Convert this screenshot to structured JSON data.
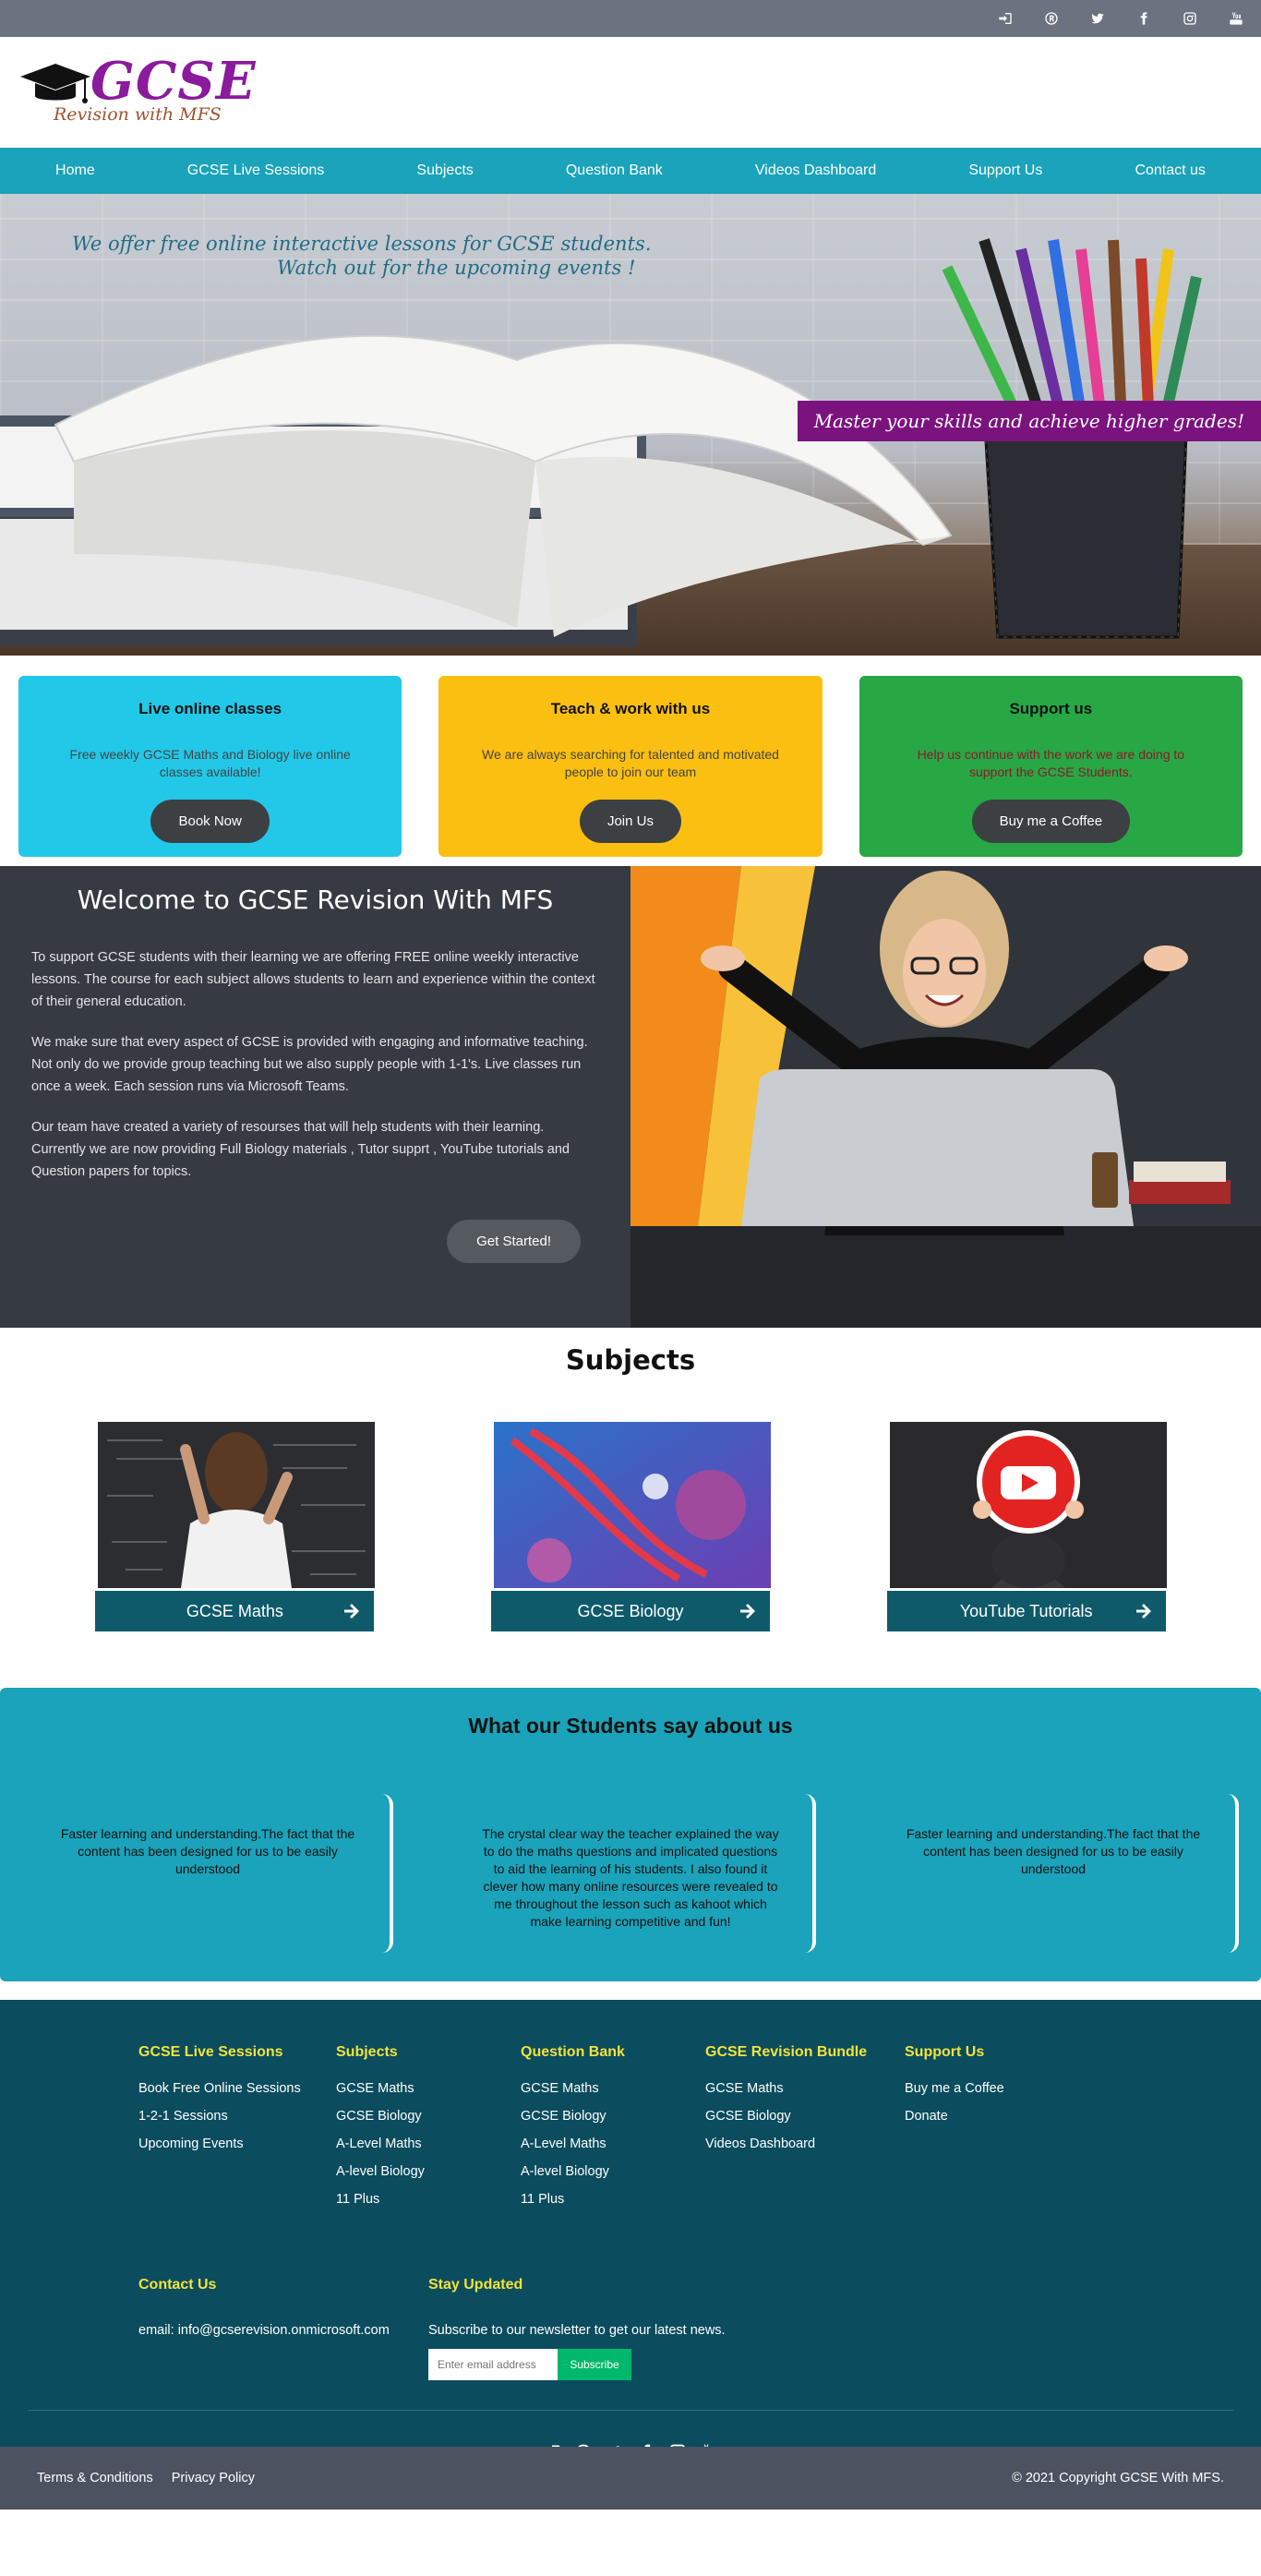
{
  "topbar": {
    "icons": [
      "login-icon",
      "registered-icon",
      "twitter-icon",
      "facebook-icon",
      "instagram-icon",
      "youtube-icon"
    ]
  },
  "logo": {
    "word": "GCSE",
    "tagline": "Revision with MFS"
  },
  "nav": {
    "items": [
      "Home",
      "GCSE Live Sessions",
      "Subjects",
      "Question Bank",
      "Videos Dashboard",
      "Support Us",
      "Contact us"
    ]
  },
  "hero": {
    "line1": "We offer free online interactive lessons for GCSE students.",
    "line2": "Watch out for the upcoming events !",
    "banner": "Master your skills and achieve higher grades!"
  },
  "cards": [
    {
      "title": "Live online classes",
      "text": "Free weekly GCSE Maths and Biology live online classes available!",
      "button": "Book Now",
      "color": "#22c8e8"
    },
    {
      "title": "Teach & work with us",
      "text": "We are always searching for talented and motivated people to join our team",
      "button": "Join Us",
      "color": "#fbbf11"
    },
    {
      "title": "Support us",
      "text": "Help us continue with the work we are doing to support the GCSE Students.",
      "button": "Buy me a Coffee",
      "color": "#28a745"
    }
  ],
  "welcome": {
    "title": "Welcome to GCSE Revision With MFS",
    "p1": "To support GCSE students with their learning we are offering FREE online weekly interactive lessons. The course for each subject allows students to learn and experience within the context of their general education.",
    "p2": "We make sure that every aspect of GCSE is provided with engaging and informative teaching. Not only do we provide group teaching but we also supply people with 1-1's. Live classes run once a week. Each session runs via Microsoft Teams.",
    "p3": "Our team have created a variety of resourses that will help students with their learning. Currently we are now providing Full Biology materials , Tutor supprt , YouTube tutorials and Question papers for topics.",
    "button": "Get Started!"
  },
  "subjects": {
    "title": "Subjects",
    "items": [
      "GCSE Maths",
      "GCSE Biology",
      "YouTube Tutorials"
    ]
  },
  "testimonials": {
    "title": "What our Students say about us",
    "items": [
      "Faster learning and understanding.The fact that the content has been designed for us to be easily understood",
      "The crystal clear way the teacher explained the way to do the maths questions and implicated questions to aid the learning of his students. I also found it clever how many online resources were revealed to me throughout the lesson such as kahoot which make learning competitive and fun!",
      "Faster learning and understanding.The fact that the content has been designed for us to be easily understood"
    ]
  },
  "footer": {
    "columns": [
      {
        "title": "GCSE Live Sessions",
        "links": [
          "Book Free Online Sessions",
          "1-2-1 Sessions",
          "Upcoming Events"
        ]
      },
      {
        "title": "Subjects",
        "links": [
          "GCSE Maths",
          "GCSE Biology",
          "A-Level Maths",
          "A-level Biology",
          "11 Plus"
        ]
      },
      {
        "title": "Question Bank",
        "links": [
          "GCSE Maths",
          "GCSE Biology",
          "A-Level Maths",
          "A-level Biology",
          "11 Plus"
        ]
      },
      {
        "title": "GCSE Revision Bundle",
        "links": [
          "GCSE Maths",
          "GCSE Biology",
          "Videos Dashboard"
        ]
      },
      {
        "title": "Support Us",
        "links": [
          "Buy me a Coffee",
          "Donate"
        ]
      }
    ],
    "contact": {
      "title": "Contact Us",
      "email": "email: info@gcserevision.onmicrosoft.com"
    },
    "stay": {
      "title": "Stay Updated",
      "text": "Subscribe to our newsletter to get our latest news.",
      "placeholder": "Enter email address",
      "button": "Subscribe"
    },
    "terms": "Terms & Conditions",
    "privacy": "Privacy Policy",
    "copyright": "© 2021 Copyright GCSE With MFS."
  }
}
